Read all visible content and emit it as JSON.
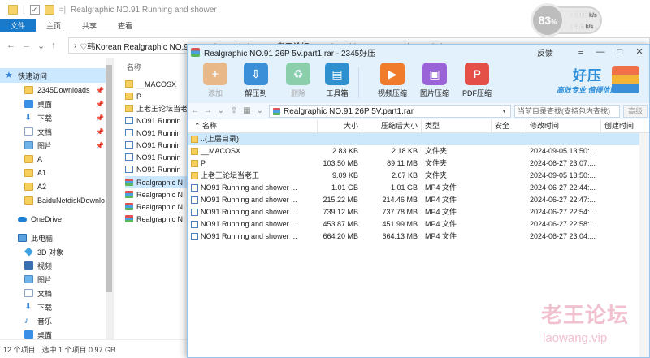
{
  "explorer": {
    "title": "Realgraphic NO.91 Running and shower",
    "ribbon_tabs": [
      "文件",
      "主页",
      "共享",
      "查看"
    ],
    "address_path": "♡韩Korean Realgraphic NO.91 Running and shower · 老王论坛 · Realgraphic NO.91 Running and shower",
    "list_header": "名称",
    "nav": [
      {
        "label": "快速访问",
        "icon": "star-icon"
      },
      {
        "label": "2345Downloads",
        "icon": "folder-icon"
      },
      {
        "label": "桌面",
        "icon": "desktop-icon"
      },
      {
        "label": "下载",
        "icon": "download-icon"
      },
      {
        "label": "文档",
        "icon": "document-icon"
      },
      {
        "label": "图片",
        "icon": "picture-icon"
      },
      {
        "label": "A",
        "icon": "folder-icon"
      },
      {
        "label": "A1",
        "icon": "folder-icon"
      },
      {
        "label": "A2",
        "icon": "folder-icon"
      },
      {
        "label": "BaiduNetdiskDownlo",
        "icon": "folder-icon"
      },
      {
        "label": "OneDrive",
        "icon": "cloud-icon"
      },
      {
        "label": "此电脑",
        "icon": "computer-icon"
      },
      {
        "label": "3D 对象",
        "icon": "3d-objects-icon"
      },
      {
        "label": "视频",
        "icon": "video-icon"
      },
      {
        "label": "图片",
        "icon": "picture-icon"
      },
      {
        "label": "文档",
        "icon": "document-icon"
      },
      {
        "label": "下载",
        "icon": "download-icon"
      },
      {
        "label": "音乐",
        "icon": "music-icon"
      },
      {
        "label": "桌面",
        "icon": "desktop-icon"
      }
    ],
    "files": [
      {
        "name": "__MACOSX",
        "icon": "folder-icon"
      },
      {
        "name": "P",
        "icon": "folder-icon"
      },
      {
        "name": "上老王论坛当老",
        "icon": "folder-icon"
      },
      {
        "name": "NO91 Runnin",
        "icon": "video-file-icon"
      },
      {
        "name": "NO91 Runnin",
        "icon": "video-file-icon"
      },
      {
        "name": "NO91 Runnin",
        "icon": "video-file-icon"
      },
      {
        "name": "NO91 Runnin",
        "icon": "video-file-icon"
      },
      {
        "name": "NO91 Runnin",
        "icon": "video-file-icon"
      },
      {
        "name": "Realgraphic N",
        "icon": "rar-icon"
      },
      {
        "name": "Realgraphic N",
        "icon": "rar-icon"
      },
      {
        "name": "Realgraphic N",
        "icon": "rar-icon"
      },
      {
        "name": "Realgraphic N",
        "icon": "rar-icon"
      }
    ],
    "status": {
      "count": "12 个项目",
      "selected": "选中 1 个项目  0.97 GB"
    }
  },
  "widget": {
    "percent": "83",
    "unit": "%",
    "upload": "20.8",
    "upload_unit": "k/s",
    "download": "4.6",
    "download_unit": "k/s"
  },
  "haozip": {
    "title": "Realgraphic NO.91 26P 5V.part1.rar - 2345好压",
    "feedback": "反馈",
    "controls": [
      "≡",
      "—",
      "□",
      "✕"
    ],
    "toolbar": [
      {
        "label": "添加",
        "icon": "add-icon",
        "color": "#f08a2c",
        "enabled": false
      },
      {
        "label": "解压到",
        "icon": "extract-icon",
        "color": "#3a8fd8",
        "enabled": true
      },
      {
        "label": "删除",
        "icon": "delete-icon",
        "color": "#45b36a",
        "enabled": false
      },
      {
        "label": "工具箱",
        "icon": "toolbox-icon",
        "color": "#2f90d0",
        "enabled": true
      },
      {
        "label": "视频压缩",
        "icon": "video-compress-icon",
        "color": "#f07b2a",
        "enabled": true
      },
      {
        "label": "图片压缩",
        "icon": "image-compress-icon",
        "color": "#9a64d8",
        "enabled": true
      },
      {
        "label": "PDF压缩",
        "icon": "pdf-compress-icon",
        "color": "#e45048",
        "enabled": true
      }
    ],
    "brand": {
      "name": "好压",
      "slogan": "高效专业 值得信赖"
    },
    "address": {
      "path": "Realgraphic NO.91 26P 5V.part1.rar",
      "search_placeholder": "当前目录查找(支持包内查找)",
      "advanced": "高级"
    },
    "columns": [
      "名称",
      "大小",
      "压缩后大小",
      "类型",
      "安全",
      "修改时间",
      "创建时间"
    ],
    "up_row": "..(上层目录)",
    "rows": [
      {
        "name": "__MACOSX",
        "size": "2.83 KB",
        "packed": "2.18 KB",
        "type": "文件夹",
        "modified": "2024-09-05 13:50:...",
        "icon": "folder-icon"
      },
      {
        "name": "P",
        "size": "103.50 MB",
        "packed": "89.11 MB",
        "type": "文件夹",
        "modified": "2024-06-27 23:07:...",
        "icon": "folder-icon"
      },
      {
        "name": "上老王论坛当老王",
        "size": "9.09 KB",
        "packed": "2.67 KB",
        "type": "文件夹",
        "modified": "2024-09-05 13:50:...",
        "icon": "folder-icon"
      },
      {
        "name": "NO91 Running and shower ...",
        "size": "1.01 GB",
        "packed": "1.01 GB",
        "type": "MP4 文件",
        "modified": "2024-06-27 22:44:...",
        "icon": "video-file-icon"
      },
      {
        "name": "NO91 Running and shower ...",
        "size": "215.22 MB",
        "packed": "214.46 MB",
        "type": "MP4 文件",
        "modified": "2024-06-27 22:47:...",
        "icon": "video-file-icon"
      },
      {
        "name": "NO91 Running and shower ...",
        "size": "739.12 MB",
        "packed": "737.78 MB",
        "type": "MP4 文件",
        "modified": "2024-06-27 22:54:...",
        "icon": "video-file-icon"
      },
      {
        "name": "NO91 Running and shower ...",
        "size": "453.87 MB",
        "packed": "451.99 MB",
        "type": "MP4 文件",
        "modified": "2024-06-27 22:58:...",
        "icon": "video-file-icon"
      },
      {
        "name": "NO91 Running and shower ...",
        "size": "664.20 MB",
        "packed": "664.13 MB",
        "type": "MP4 文件",
        "modified": "2024-06-27 23:04:...",
        "icon": "video-file-icon"
      }
    ]
  },
  "watermark": {
    "cn": "老王论坛",
    "en": "laowang.vip"
  }
}
